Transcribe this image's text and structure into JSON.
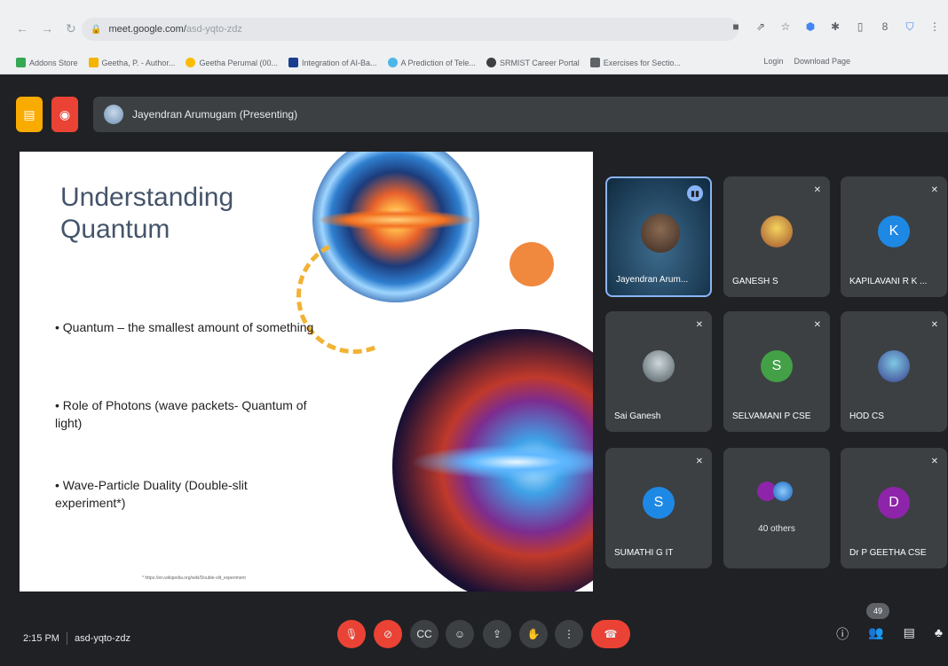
{
  "browser": {
    "url_host": "meet.google.com/",
    "url_path": "asd-yqto-zdz",
    "bookmarks": [
      {
        "label": "Addons Store",
        "color": "#34a853"
      },
      {
        "label": "Geetha, P. - Author...",
        "color": "#f4b400"
      },
      {
        "label": "Geetha Perumal (00...",
        "color": "#fbbc05"
      },
      {
        "label": "Integration of AI-Ba...",
        "color": "#1a3d8f"
      },
      {
        "label": "A Prediction of Tele...",
        "color": "#4db6e8"
      },
      {
        "label": "SRMIST Career Portal",
        "color": "#3c4043"
      },
      {
        "label": "Exercises for Sectio...",
        "color": "#5f6368"
      }
    ],
    "bookmarks_right": [
      "Login",
      "Download Page"
    ]
  },
  "meet": {
    "presenter_label": "Jayendran Arumugam (Presenting)",
    "meeting_time": "2:15 PM",
    "meeting_code": "asd-yqto-zdz",
    "participant_count": "49",
    "accent": "#8ab4f8",
    "danger": "#ea4335"
  },
  "slide": {
    "title_line1": "Understanding",
    "title_line2": "Quantum",
    "bullets": [
      "• Quantum – the smallest amount of something",
      "• Role of Photons (wave packets- Quantum of light)",
      "• Wave-Particle Duality (Double-slit experiment*)"
    ],
    "footnote": "* https://en.wikipedia.org/wiki/Double-slit_experiment"
  },
  "participants": [
    {
      "name": "Jayendran Arum...",
      "type": "video",
      "speaking": true
    },
    {
      "name": "GANESH S",
      "type": "photo",
      "muted": true
    },
    {
      "name": "KAPILAVANI R K ...",
      "type": "letter",
      "letter": "K",
      "color": "#1e88e5",
      "muted": true
    },
    {
      "name": "Sai Ganesh",
      "type": "photo",
      "muted": true
    },
    {
      "name": "SELVAMANI P CSE",
      "type": "letter",
      "letter": "S",
      "color": "#43a047",
      "muted": true
    },
    {
      "name": "HOD CS",
      "type": "photo",
      "muted": true
    },
    {
      "name": "SUMATHI G IT",
      "type": "letter",
      "letter": "S",
      "color": "#1e88e5",
      "muted": true
    },
    {
      "name": "40 others",
      "type": "group"
    },
    {
      "name": "Dr P GEETHA CSE",
      "type": "letter",
      "letter": "D",
      "color": "#8e24aa",
      "muted": true
    }
  ]
}
